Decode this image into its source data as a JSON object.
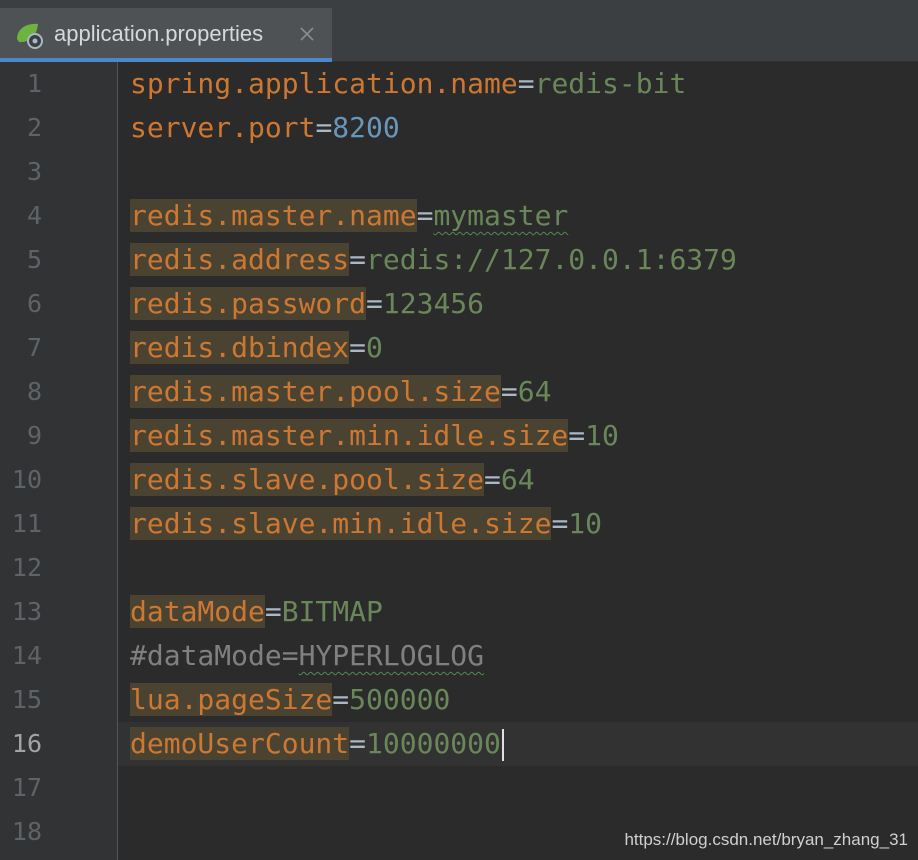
{
  "tab": {
    "title": "application.properties",
    "icon": "spring-leaf-icon",
    "close_icon": "close-icon",
    "accent": "#4a88c7"
  },
  "editor": {
    "current_line": 16,
    "lines": [
      {
        "n": "1",
        "key": "spring.application.name",
        "eq": "=",
        "value": "redis-bit"
      },
      {
        "n": "2",
        "key": "server.port",
        "eq": "=",
        "value": "8200"
      },
      {
        "n": "3"
      },
      {
        "n": "4",
        "key": "redis.master.name",
        "eq": "=",
        "value": "mymaster"
      },
      {
        "n": "5",
        "key": "redis.address",
        "eq": "=",
        "value": "redis://127.0.0.1:6379"
      },
      {
        "n": "6",
        "key": "redis.password",
        "eq": "=",
        "value": "123456"
      },
      {
        "n": "7",
        "key": "redis.dbindex",
        "eq": "=",
        "value": "0"
      },
      {
        "n": "8",
        "key": "redis.master.pool.size",
        "eq": "=",
        "value": "64"
      },
      {
        "n": "9",
        "key": "redis.master.min.idle.size",
        "eq": "=",
        "value": "10"
      },
      {
        "n": "10",
        "key": "redis.slave.pool.size",
        "eq": "=",
        "value": "64"
      },
      {
        "n": "11",
        "key": "redis.slave.min.idle.size",
        "eq": "=",
        "value": "10"
      },
      {
        "n": "12"
      },
      {
        "n": "13",
        "key": "dataMode",
        "eq": "=",
        "value": "BITMAP"
      },
      {
        "n": "14",
        "comment": "#dataMode=",
        "value": "HYPERLOGLOG"
      },
      {
        "n": "15",
        "key": "lua.pageSize",
        "eq": "=",
        "value": "500000"
      },
      {
        "n": "16",
        "key": "demoUserCount",
        "eq": "=",
        "value": "10000000"
      },
      {
        "n": "17"
      },
      {
        "n": "18"
      }
    ]
  },
  "watermark": "https://blog.csdn.net/bryan_zhang_31",
  "colors": {
    "background": "#2b2b2b",
    "key": "#cc7832",
    "key_highlight": "#4b4332",
    "value": "#6a8759",
    "number": "#6897bb",
    "comment": "#808080"
  }
}
